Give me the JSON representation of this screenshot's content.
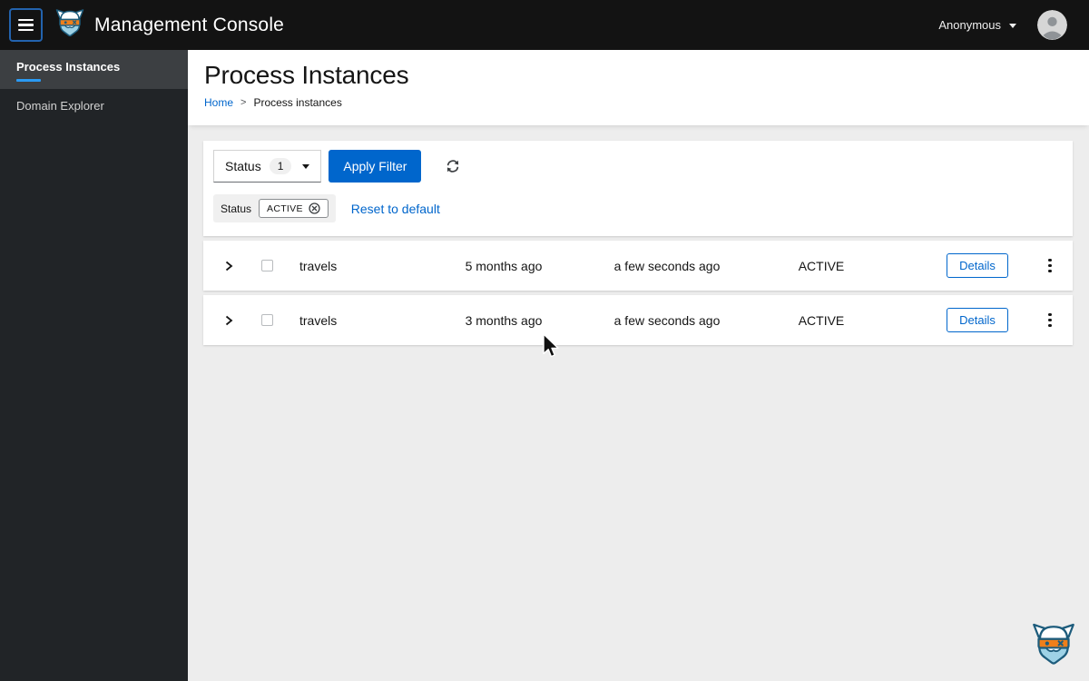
{
  "colors": {
    "accent_blue": "#0066cc",
    "nav_active_underline": "#2b9af3",
    "header_bg": "#131313",
    "sidebar_bg": "#212427",
    "content_bg": "#ededed"
  },
  "header": {
    "app_title": "Management Console",
    "user_label": "Anonymous"
  },
  "sidebar": {
    "items": [
      {
        "label": "Process Instances"
      },
      {
        "label": "Domain Explorer"
      }
    ]
  },
  "page": {
    "title": "Process Instances",
    "breadcrumb": {
      "home": "Home",
      "separator": ">",
      "current": "Process instances"
    }
  },
  "filters": {
    "select_label": "Status",
    "select_badge": "1",
    "apply_button": "Apply Filter",
    "chip_group_label": "Status",
    "chip": "ACTIVE",
    "reset_link": "Reset to default"
  },
  "table": {
    "rows": [
      {
        "name": "travels",
        "started": "5 months ago",
        "updated": "a few seconds ago",
        "state": "ACTIVE",
        "details": "Details"
      },
      {
        "name": "travels",
        "started": "3 months ago",
        "updated": "a few seconds ago",
        "state": "ACTIVE",
        "details": "Details"
      }
    ]
  }
}
